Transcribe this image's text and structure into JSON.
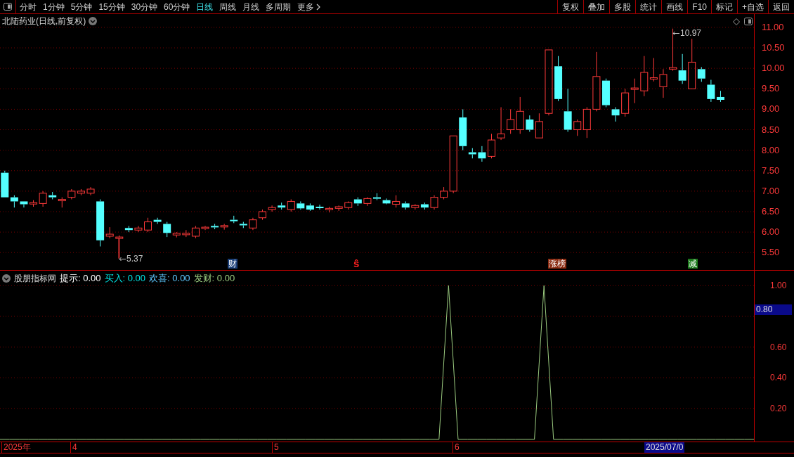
{
  "toolbar": {
    "periods": [
      {
        "label": "分时",
        "selected": false
      },
      {
        "label": "1分钟",
        "selected": false
      },
      {
        "label": "5分钟",
        "selected": false
      },
      {
        "label": "15分钟",
        "selected": false
      },
      {
        "label": "30分钟",
        "selected": false
      },
      {
        "label": "60分钟",
        "selected": false
      },
      {
        "label": "日线",
        "selected": true
      },
      {
        "label": "周线",
        "selected": false
      },
      {
        "label": "月线",
        "selected": false
      },
      {
        "label": "多周期",
        "selected": false
      },
      {
        "label": "更多",
        "selected": false
      }
    ],
    "buttons": [
      "复权",
      "叠加",
      "多股",
      "统计",
      "画线",
      "F10",
      "标记",
      "+自选",
      "返回"
    ]
  },
  "main_chart": {
    "title": "北陆药业(日线,前复权)",
    "high_label": "10.97",
    "low_label": "5.37",
    "events": [
      {
        "text": "财",
        "kind": "tag",
        "color": "#1b3f78"
      },
      {
        "text": "ŝ",
        "kind": "text",
        "color": "#ff2020"
      },
      {
        "text": "涨榜",
        "kind": "tag",
        "color": "#8a2a10"
      },
      {
        "text": "减",
        "kind": "tag",
        "color": "#1c7a1c"
      }
    ],
    "chart_data": {
      "type": "candlestick",
      "grid": true,
      "ylim": [
        5.075,
        11.325
      ],
      "yticks": [
        {
          "value": 11,
          "label": "11.00"
        },
        {
          "value": 10.5,
          "label": "10.50"
        },
        {
          "value": 10,
          "label": "10.00"
        },
        {
          "value": 9.5,
          "label": "9.50"
        },
        {
          "value": 9,
          "label": "9.00"
        },
        {
          "value": 8.5,
          "label": "8.50"
        },
        {
          "value": 8,
          "label": "8.00"
        },
        {
          "value": 7.5,
          "label": "7.50"
        },
        {
          "value": 7,
          "label": "7.00"
        },
        {
          "value": 6.5,
          "label": "6.50"
        },
        {
          "value": 6,
          "label": "6.00"
        },
        {
          "value": 5.5,
          "label": "5.50"
        }
      ],
      "ohlc": [
        [
          7.45,
          7.5,
          6.85,
          6.85
        ],
        [
          6.85,
          6.9,
          6.6,
          6.75
        ],
        [
          6.75,
          6.75,
          6.6,
          6.68
        ],
        [
          6.7,
          6.78,
          6.62,
          6.72
        ],
        [
          6.7,
          7.0,
          6.62,
          6.95
        ],
        [
          6.9,
          6.98,
          6.8,
          6.85
        ],
        [
          6.78,
          6.85,
          6.6,
          6.8
        ],
        [
          6.85,
          7.05,
          6.8,
          7.0
        ],
        [
          6.95,
          7.05,
          6.9,
          7.0
        ],
        [
          6.95,
          7.1,
          6.9,
          7.05
        ],
        [
          6.75,
          6.8,
          5.65,
          5.8
        ],
        [
          5.9,
          6.12,
          5.85,
          5.95
        ],
        [
          5.85,
          5.92,
          5.37,
          5.88
        ],
        [
          6.1,
          6.15,
          6.0,
          6.05
        ],
        [
          6.05,
          6.15,
          6.0,
          6.1
        ],
        [
          6.05,
          6.35,
          6.0,
          6.25
        ],
        [
          6.3,
          6.35,
          6.2,
          6.25
        ],
        [
          6.2,
          6.25,
          5.88,
          5.98
        ],
        [
          5.93,
          6.0,
          5.87,
          5.97
        ],
        [
          5.96,
          6.05,
          5.88,
          5.97
        ],
        [
          5.9,
          6.15,
          5.85,
          6.1
        ],
        [
          6.1,
          6.15,
          6.05,
          6.12
        ],
        [
          6.15,
          6.2,
          6.07,
          6.13
        ],
        [
          6.13,
          6.2,
          6.06,
          6.16
        ],
        [
          6.3,
          6.4,
          6.22,
          6.28
        ],
        [
          6.2,
          6.25,
          6.1,
          6.18
        ],
        [
          6.1,
          6.35,
          6.05,
          6.3
        ],
        [
          6.35,
          6.55,
          6.3,
          6.5
        ],
        [
          6.55,
          6.65,
          6.5,
          6.6
        ],
        [
          6.65,
          6.72,
          6.55,
          6.6
        ],
        [
          6.55,
          6.8,
          6.5,
          6.75
        ],
        [
          6.7,
          6.75,
          6.55,
          6.58
        ],
        [
          6.65,
          6.7,
          6.52,
          6.55
        ],
        [
          6.62,
          6.67,
          6.55,
          6.6
        ],
        [
          6.55,
          6.62,
          6.48,
          6.58
        ],
        [
          6.58,
          6.65,
          6.52,
          6.62
        ],
        [
          6.6,
          6.75,
          6.55,
          6.72
        ],
        [
          6.8,
          6.85,
          6.64,
          6.7
        ],
        [
          6.7,
          6.85,
          6.64,
          6.82
        ],
        [
          6.85,
          6.95,
          6.78,
          6.82
        ],
        [
          6.78,
          6.82,
          6.68,
          6.7
        ],
        [
          6.68,
          6.9,
          6.6,
          6.75
        ],
        [
          6.7,
          6.75,
          6.55,
          6.6
        ],
        [
          6.6,
          6.68,
          6.55,
          6.65
        ],
        [
          6.68,
          6.72,
          6.55,
          6.6
        ],
        [
          6.6,
          6.9,
          6.55,
          6.85
        ],
        [
          6.85,
          7.1,
          6.8,
          7.0
        ],
        [
          7.0,
          8.35,
          6.95,
          8.35
        ],
        [
          8.8,
          9.0,
          8.0,
          8.1
        ],
        [
          7.95,
          8.05,
          7.8,
          7.9
        ],
        [
          7.95,
          8.1,
          7.72,
          7.8
        ],
        [
          7.85,
          8.4,
          7.8,
          8.25
        ],
        [
          8.3,
          9.05,
          8.25,
          8.4
        ],
        [
          8.5,
          9.0,
          8.4,
          8.75
        ],
        [
          8.5,
          9.3,
          8.4,
          8.95
        ],
        [
          8.75,
          8.85,
          8.45,
          8.5
        ],
        [
          8.3,
          8.9,
          8.3,
          8.7
        ],
        [
          8.9,
          10.45,
          8.85,
          10.45
        ],
        [
          10.05,
          10.3,
          9.2,
          9.25
        ],
        [
          8.95,
          9.5,
          8.45,
          8.5
        ],
        [
          8.5,
          8.75,
          8.35,
          8.7
        ],
        [
          8.5,
          9.05,
          8.3,
          9.0
        ],
        [
          9.0,
          10.4,
          8.95,
          9.8
        ],
        [
          9.7,
          9.75,
          9.05,
          9.1
        ],
        [
          9.0,
          9.05,
          8.7,
          8.85
        ],
        [
          8.9,
          9.5,
          8.82,
          9.4
        ],
        [
          9.5,
          9.75,
          9.15,
          9.52
        ],
        [
          9.45,
          10.3,
          9.32,
          9.9
        ],
        [
          9.75,
          10.25,
          9.68,
          9.77
        ],
        [
          9.55,
          9.98,
          9.28,
          9.85
        ],
        [
          9.98,
          10.97,
          9.94,
          10.02
        ],
        [
          9.95,
          10.35,
          9.62,
          9.7
        ],
        [
          9.5,
          10.72,
          9.5,
          10.15
        ],
        [
          9.98,
          10.03,
          9.67,
          9.75
        ],
        [
          9.6,
          9.72,
          9.18,
          9.25
        ],
        [
          9.3,
          9.45,
          9.18,
          9.23
        ],
        null,
        null,
        null
      ]
    }
  },
  "indicator": {
    "name": "股朋指标网",
    "values": [
      {
        "label": "提示:",
        "value": "0.00",
        "color": "#ffffff"
      },
      {
        "label": "买入:",
        "value": "0.00",
        "color": "#00e5e5"
      },
      {
        "label": "欢喜:",
        "value": "0.00",
        "color": "#5fc8ff"
      },
      {
        "label": "发财:",
        "value": "0.00",
        "color": "#9ccc80"
      }
    ],
    "cursor_value": "0.80",
    "chart_data": {
      "type": "line",
      "grid": true,
      "ylim": [
        -0.014,
        1.097
      ],
      "yticks": [
        {
          "value": 1,
          "label": "1.00"
        },
        {
          "value": 0.6,
          "label": "0.60"
        },
        {
          "value": 0.4,
          "label": "0.40"
        },
        {
          "value": 0.2,
          "label": "0.20"
        }
      ],
      "series": [
        {
          "color": "#9ccc80",
          "values": [
            0,
            0,
            0,
            0,
            0,
            0,
            0,
            0,
            0,
            0,
            0,
            0,
            0,
            0,
            0,
            0,
            0,
            0,
            0,
            0,
            0,
            0,
            0,
            0,
            0,
            0,
            0,
            0,
            0,
            0,
            0,
            0,
            0,
            0,
            0,
            0,
            0,
            0,
            0,
            0,
            0,
            0,
            0,
            0,
            0,
            0,
            0,
            1,
            0,
            0,
            0,
            0,
            0,
            0,
            0,
            0,
            0,
            1,
            0,
            0,
            0,
            0,
            0,
            0,
            0,
            0,
            0,
            0,
            0,
            0,
            0,
            0,
            0,
            0,
            0,
            0,
            0,
            0,
            0,
            0
          ]
        }
      ]
    }
  },
  "time_axis": {
    "labels": [
      "2025年",
      "4",
      "5",
      "6"
    ],
    "cursor_date": "2025/07/0"
  }
}
